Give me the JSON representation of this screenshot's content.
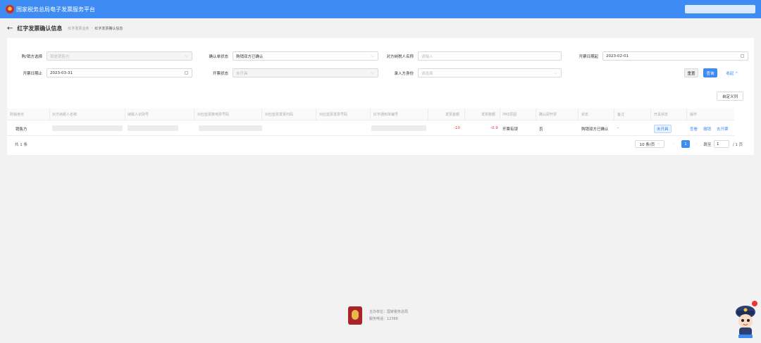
{
  "app": {
    "title": "国家税务总局电子发票服务平台"
  },
  "page": {
    "title": "红字发票确认信息",
    "breadcrumbs": [
      "红字发票业务",
      "红字发票确认信息"
    ],
    "back_icon": "←"
  },
  "filters": {
    "buyer_seller": {
      "label": "购/销方选择",
      "value": "我是销售方"
    },
    "confirm_status": {
      "label": "确认单状态",
      "value": "购销双方已确认"
    },
    "counterparty_name": {
      "label": "对方纳税人名称",
      "placeholder": "请输入"
    },
    "date_from": {
      "label": "开票日期起",
      "value": "2023-02-01"
    },
    "date_to": {
      "label": "开票日期止",
      "value": "2023-03-31"
    },
    "invoice_status": {
      "label": "开票状态",
      "value": "未开具"
    },
    "entry_identity": {
      "label": "录入方身份",
      "placeholder": "请选择"
    }
  },
  "actions": {
    "reset": "重置",
    "search": "查询",
    "collapse": "收起 ^",
    "customize_columns": "自定义列"
  },
  "table": {
    "columns": [
      "购销身份",
      "对方纳税人名称",
      "纳税人识别号",
      "对应蓝票数电票号码",
      "对应蓝票发票代码",
      "对应蓝票发票号码",
      "红字通知单编号",
      "发票金额",
      "发票税额",
      "冲红原因",
      "确认即开票",
      "状态",
      "备注",
      "开具状态",
      "操作"
    ],
    "rows": [
      {
        "identity": "销售方",
        "amount": "-10",
        "tax": "-0.9",
        "reason": "开票有误",
        "confirm_issue": "否",
        "status": "购销双方已确认",
        "remark": "-",
        "issue_status": "未开具",
        "ops": [
          "查看",
          "撤销",
          "去开票"
        ]
      }
    ]
  },
  "pagination": {
    "total": "共 1 条",
    "page_size": "10 条/页",
    "current": "1",
    "goto_label": "跳至",
    "goto_value": "1",
    "pages": "/ 1 页",
    "prev": "‹",
    "next": "›"
  },
  "footer": {
    "sponsor": "主办单位：国家税务总局",
    "hotline": "服务电话：12366"
  },
  "colors": {
    "primary": "#3d8bf3",
    "negative": "#e33333"
  }
}
